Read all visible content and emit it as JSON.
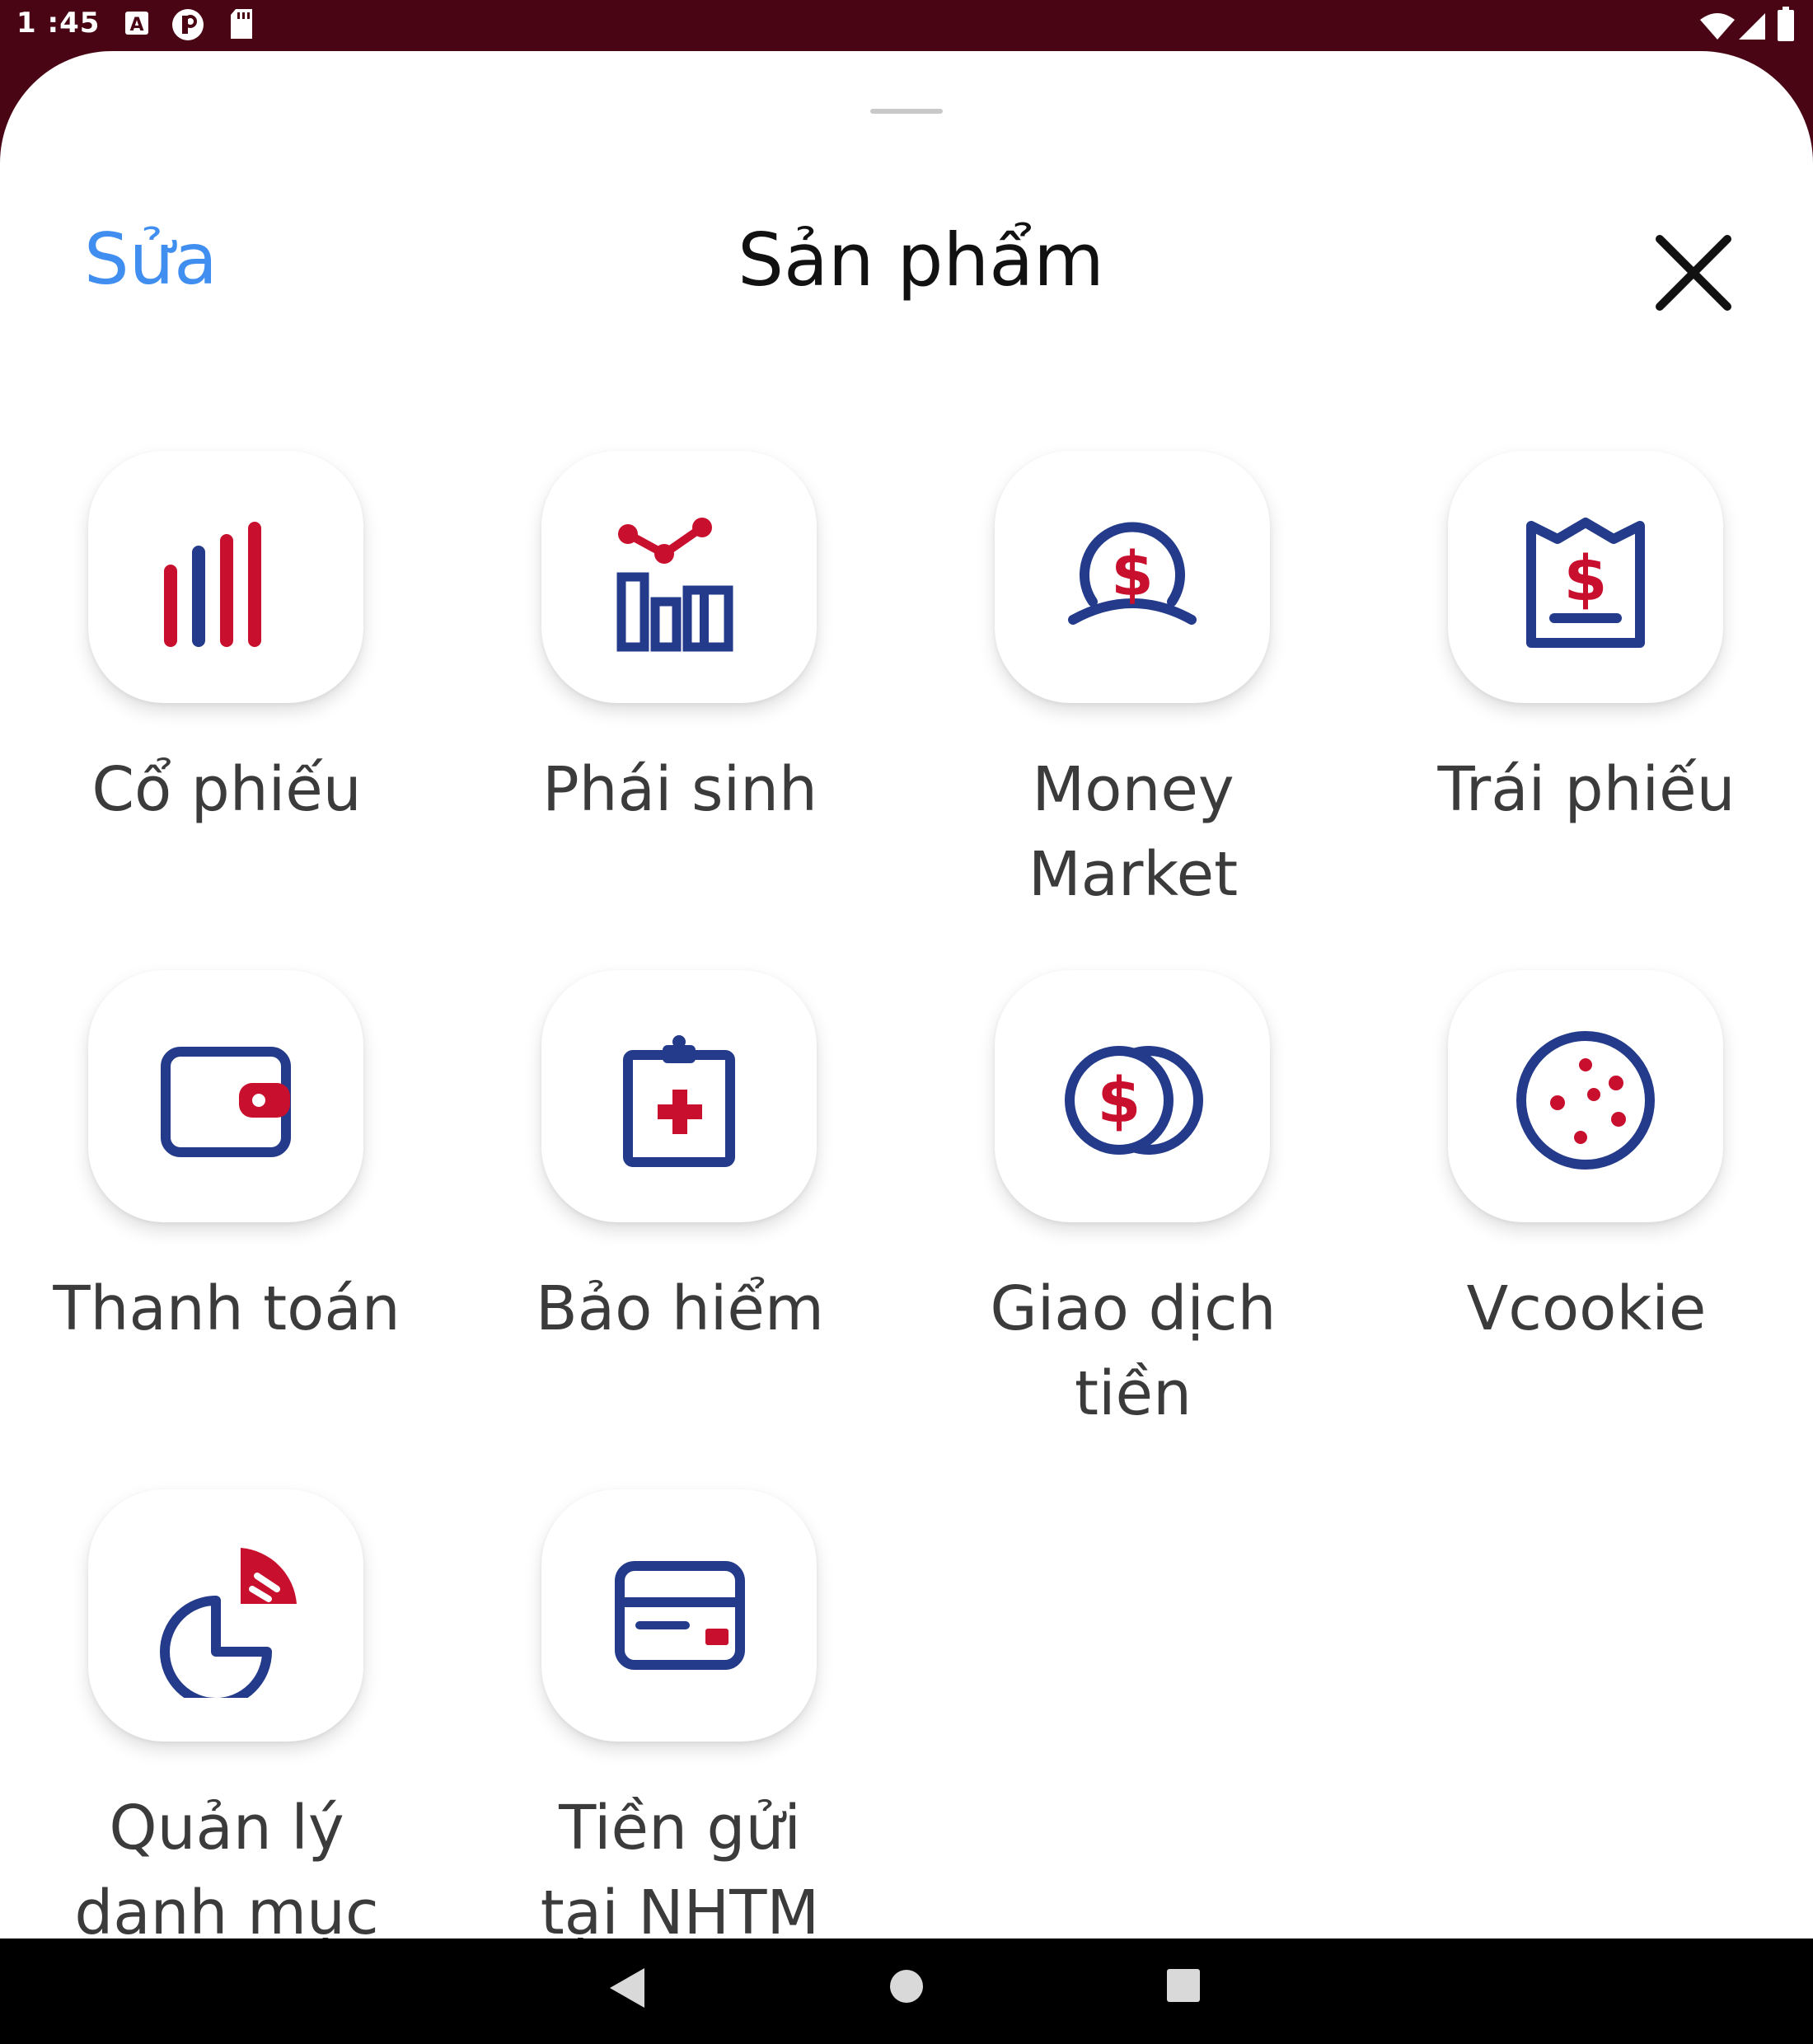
{
  "status_bar": {
    "time": "1 :45",
    "icons": [
      "a-box-icon",
      "p-circle-icon",
      "sd-card-icon",
      "wifi-icon",
      "cell-signal-icon",
      "battery-icon"
    ]
  },
  "sheet": {
    "edit_label": "Sửa",
    "title": "Sản phẩm",
    "close_icon": "close-icon"
  },
  "colors": {
    "navy": "#243a8a",
    "red": "#c8102e",
    "link": "#3f8ef0",
    "status_bar": "#4a0515"
  },
  "products": [
    {
      "label": "Cổ phiếu",
      "icon": "bar-chart-icon"
    },
    {
      "label": "Phái sinh",
      "icon": "trend-chart-icon"
    },
    {
      "label": "Money\nMarket",
      "icon": "money-market-icon"
    },
    {
      "label": "Trái phiếu",
      "icon": "bond-receipt-icon"
    },
    {
      "label": "Thanh toán",
      "icon": "wallet-icon"
    },
    {
      "label": "Bảo hiểm",
      "icon": "insurance-clipboard-icon"
    },
    {
      "label": "Giao dịch\ntiền",
      "icon": "coins-icon"
    },
    {
      "label": "Vcookie",
      "icon": "cookie-icon"
    },
    {
      "label": "Quản lý\ndanh mục",
      "icon": "pie-chart-icon"
    },
    {
      "label": "Tiền gửi\ntại NHTM",
      "icon": "bank-card-icon"
    }
  ],
  "nav_bar": {
    "icons": [
      "back-icon",
      "home-icon",
      "recents-icon"
    ]
  }
}
